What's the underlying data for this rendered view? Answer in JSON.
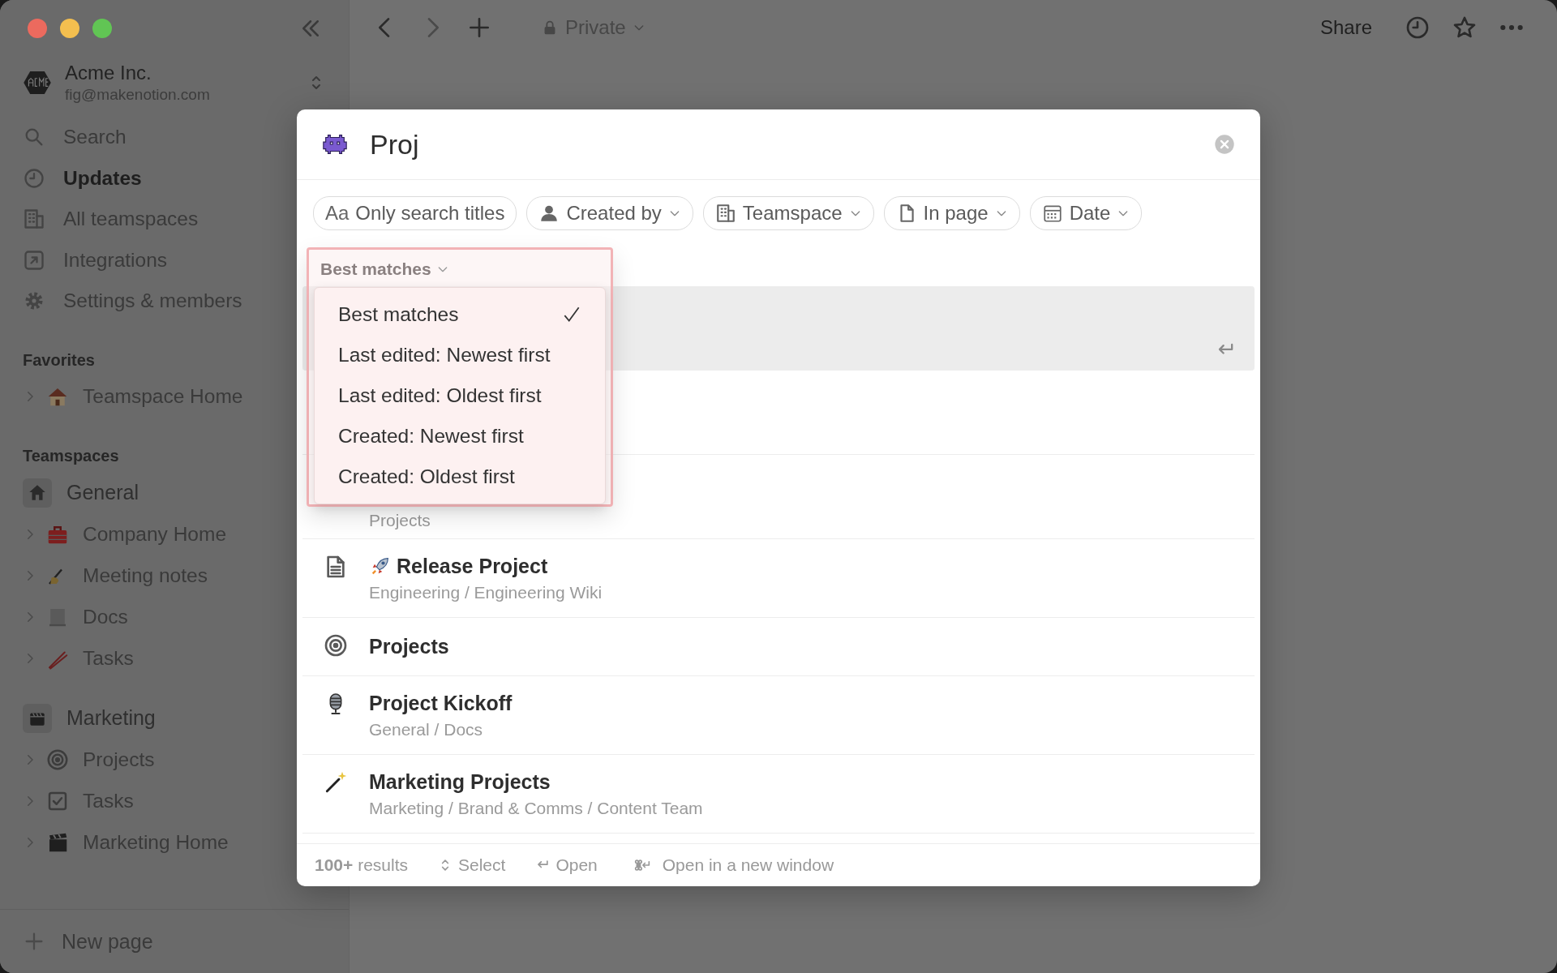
{
  "sidebar": {
    "workspace": {
      "name": "Acme Inc.",
      "email": "fig@makenotion.com"
    },
    "nav": [
      {
        "label": "Search",
        "unread": false
      },
      {
        "label": "Updates",
        "unread": true
      },
      {
        "label": "All teamspaces",
        "unread": false
      },
      {
        "label": "Integrations",
        "unread": false
      },
      {
        "label": "Settings & members",
        "unread": false
      }
    ],
    "favorites": {
      "heading": "Favorites",
      "items": [
        {
          "label": "Teamspace Home",
          "expanded": false
        }
      ]
    },
    "teamspaces": {
      "heading": "Teamspaces",
      "groups": [
        {
          "name": "General",
          "children": [
            {
              "label": "Company Home",
              "expanded": false
            },
            {
              "label": "Meeting notes",
              "expanded": false
            },
            {
              "label": "Docs",
              "expanded": false
            },
            {
              "label": "Tasks",
              "expanded": false
            }
          ]
        },
        {
          "name": "Marketing",
          "children": [
            {
              "label": "Projects",
              "expanded": false
            },
            {
              "label": "Tasks",
              "expanded": false
            },
            {
              "label": "Marketing Home",
              "expanded": false
            }
          ]
        }
      ]
    },
    "new_page": "New page"
  },
  "topbar": {
    "privacy": "Private",
    "share": "Share"
  },
  "search": {
    "query": "Proj",
    "filters": [
      {
        "kind": "toggle",
        "prefix": "Aa",
        "label": "Only search titles"
      },
      {
        "kind": "menu",
        "label": "Created by"
      },
      {
        "kind": "menu",
        "label": "Teamspace"
      },
      {
        "kind": "menu",
        "label": "In page"
      },
      {
        "kind": "menu",
        "label": "Date"
      }
    ],
    "sort": {
      "label": "Best matches",
      "options": [
        {
          "label": "Best matches",
          "selected": true
        },
        {
          "label": "Last edited: Newest first",
          "selected": false
        },
        {
          "label": "Last edited: Oldest first",
          "selected": false
        },
        {
          "label": "Created: Newest first",
          "selected": false
        },
        {
          "label": "Created: Oldest first",
          "selected": false
        }
      ]
    },
    "results": [
      {
        "selected": true
      },
      {
        "selected": false
      },
      {
        "path": "Projects",
        "selected": false
      },
      {
        "title": "Release Project",
        "path": "Engineering / Engineering Wiki",
        "selected": false
      },
      {
        "title": "Projects",
        "selected": false
      },
      {
        "title": "Project Kickoff",
        "path": "General / Docs",
        "selected": false
      },
      {
        "title": "Marketing Projects",
        "path": "Marketing / Brand & Comms / Content Team",
        "selected": false
      }
    ],
    "footer": {
      "count": "**100+** results",
      "hints": [
        "Select",
        "Open",
        "Open in a new window"
      ]
    }
  }
}
